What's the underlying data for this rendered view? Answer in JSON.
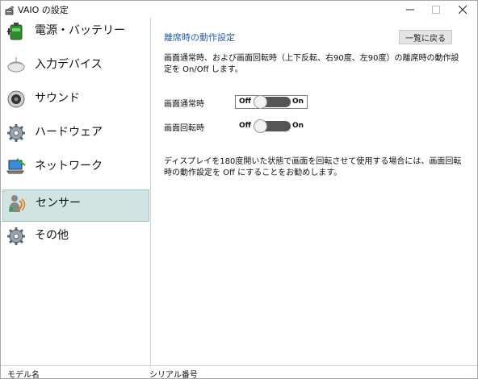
{
  "window": {
    "title": "VAIO の設定",
    "controls": [
      "minimize",
      "maximize",
      "close"
    ]
  },
  "sidebar": {
    "items": [
      {
        "label": "電源・バッテリー",
        "icon": "battery-plug-icon"
      },
      {
        "label": "入力デバイス",
        "icon": "mouse-icon"
      },
      {
        "label": "サウンド",
        "icon": "speaker-icon"
      },
      {
        "label": "ハードウェア",
        "icon": "gear-icon"
      },
      {
        "label": "ネットワーク",
        "icon": "network-laptop-icon"
      },
      {
        "label": "センサー",
        "icon": "sensor-person-icon",
        "selected": true
      },
      {
        "label": "その他",
        "icon": "gear-icon"
      }
    ],
    "selected_bg": "#cfe4e3"
  },
  "main": {
    "section_title": "離席時の動作設定",
    "back_button": "一覧に戻る",
    "description": "画面通常時、および画面回転時（上下反転、右90度、左90度）の離席時の動作設定を On/Off します。",
    "toggles": [
      {
        "label": "画面通常時",
        "off_text": "Off",
        "on_text": "On",
        "state": "off",
        "focused": true
      },
      {
        "label": "画面回転時",
        "off_text": "Off",
        "on_text": "On",
        "state": "off",
        "focused": false
      }
    ],
    "note": "ディスプレイを180度開いた状態で画面を回転させて使用する場合には、画面回転時の動作設定を Off にすることをお勧めします。"
  },
  "status_bar": {
    "model_label": "モデル名",
    "serial_label": "シリアル番号"
  },
  "colors": {
    "accent_text": "#2a5fa8",
    "toggle_track": "#555555"
  }
}
